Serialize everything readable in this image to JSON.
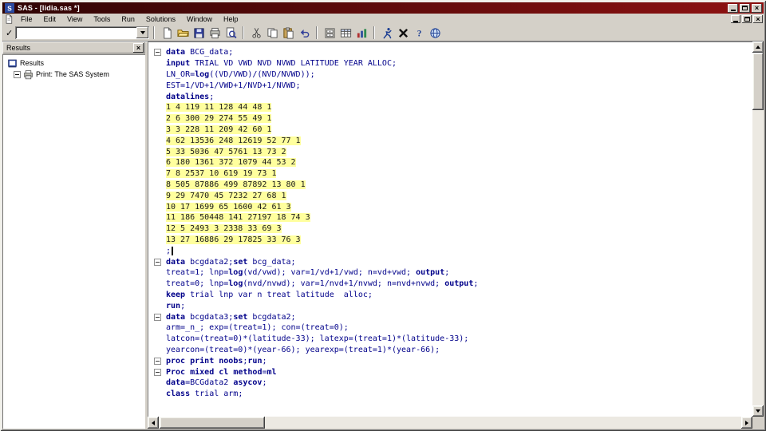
{
  "window": {
    "title": "SAS - [lidia.sas *]"
  },
  "menu_bar": {
    "items": [
      "File",
      "Edit",
      "View",
      "Tools",
      "Run",
      "Solutions",
      "Window",
      "Help"
    ]
  },
  "toolbar": {
    "command": {
      "value": "",
      "check_icon": "check-icon"
    },
    "buttons": [
      {
        "name": "new-document",
        "group": 1
      },
      {
        "name": "open-folder",
        "group": 1
      },
      {
        "name": "save",
        "group": 1
      },
      {
        "name": "print",
        "group": 1
      },
      {
        "name": "print-preview",
        "group": 1
      },
      {
        "name": "cut",
        "group": 2
      },
      {
        "name": "copy",
        "group": 2
      },
      {
        "name": "paste",
        "group": 2
      },
      {
        "name": "undo",
        "group": 2
      },
      {
        "name": "new-library",
        "group": 3
      },
      {
        "name": "table-editor",
        "group": 3
      },
      {
        "name": "graphics",
        "group": 3
      },
      {
        "name": "submit-run",
        "group": 4
      },
      {
        "name": "break",
        "group": 4
      },
      {
        "name": "help",
        "group": 4
      },
      {
        "name": "online-docs",
        "group": 4
      }
    ]
  },
  "results_panel": {
    "title": "Results",
    "items": [
      {
        "label": "Results",
        "level": 0,
        "icon": "book",
        "expander": "none"
      },
      {
        "label": "Print: The SAS System",
        "level": 1,
        "icon": "printer",
        "expander": "minus"
      }
    ]
  },
  "editor": {
    "keywords": [
      "data",
      "input",
      "datalines",
      "set",
      "keep",
      "run",
      "proc",
      "print",
      "mixed",
      "class",
      "output",
      "log",
      "method",
      "cl",
      "ml",
      "noobs",
      "asycov"
    ],
    "lines": [
      {
        "t": "data BCG_data;",
        "fold": true
      },
      {
        "t": "input TRIAL VD VWD NVD NVWD LATITUDE YEAR ALLOC;"
      },
      {
        "t": "LN_OR=log((VD/VWD)/(NVD/NVWD));"
      },
      {
        "t": "EST=1/VD+1/VWD+1/NVD+1/NVWD;"
      },
      {
        "t": "datalines;"
      },
      {
        "t": "1 4 119 11 128 44 48 1",
        "kind": "data"
      },
      {
        "t": "2 6 300 29 274 55 49 1",
        "kind": "data"
      },
      {
        "t": "3 3 228 11 209 42 60 1",
        "kind": "data"
      },
      {
        "t": "4 62 13536 248 12619 52 77 1",
        "kind": "data"
      },
      {
        "t": "5 33 5036 47 5761 13 73 2",
        "kind": "data"
      },
      {
        "t": "6 180 1361 372 1079 44 53 2",
        "kind": "data"
      },
      {
        "t": "7 8 2537 10 619 19 73 1",
        "kind": "data"
      },
      {
        "t": "8 505 87886 499 87892 13 80 1",
        "kind": "data"
      },
      {
        "t": "9 29 7470 45 7232 27 68 1",
        "kind": "data"
      },
      {
        "t": "10 17 1699 65 1600 42 61 3",
        "kind": "data"
      },
      {
        "t": "11 186 50448 141 27197 18 74 3",
        "kind": "data"
      },
      {
        "t": "12 5 2493 3 2338 33 69 3",
        "kind": "data"
      },
      {
        "t": "13 27 16886 29 17825 33 76 3",
        "kind": "data"
      },
      {
        "t": ";",
        "caret": true
      },
      {
        "t": "data bcgdata2;set bcg_data;",
        "fold": true
      },
      {
        "t": "treat=1; lnp=log(vd/vwd); var=1/vd+1/vwd; n=vd+vwd; output;"
      },
      {
        "t": "treat=0; lnp=log(nvd/nvwd); var=1/nvd+1/nvwd; n=nvd+nvwd; output;"
      },
      {
        "t": "keep trial lnp var n treat latitude  alloc;"
      },
      {
        "t": "run;"
      },
      {
        "t": "data bcgdata3;set bcgdata2;",
        "fold": true
      },
      {
        "t": "arm=_n_; exp=(treat=1); con=(treat=0);"
      },
      {
        "t": "latcon=(treat=0)*(latitude-33); latexp=(treat=1)*(latitude-33);"
      },
      {
        "t": "yearcon=(treat=0)*(year-66); yearexp=(treat=1)*(year-66);"
      },
      {
        "t": "proc print noobs;run;",
        "fold": true
      },
      {
        "t": "Proc mixed cl method=ml",
        "fold": true
      },
      {
        "t": "data=BCGdata2 asycov;"
      },
      {
        "t": "class trial arm;"
      }
    ]
  },
  "colors": {
    "titlebar_left": "#2f0404",
    "titlebar_right": "#8e1212",
    "code_text": "#00008a",
    "data_highlight": "#ffff9e",
    "chrome_gray": "#d4d0c8"
  }
}
